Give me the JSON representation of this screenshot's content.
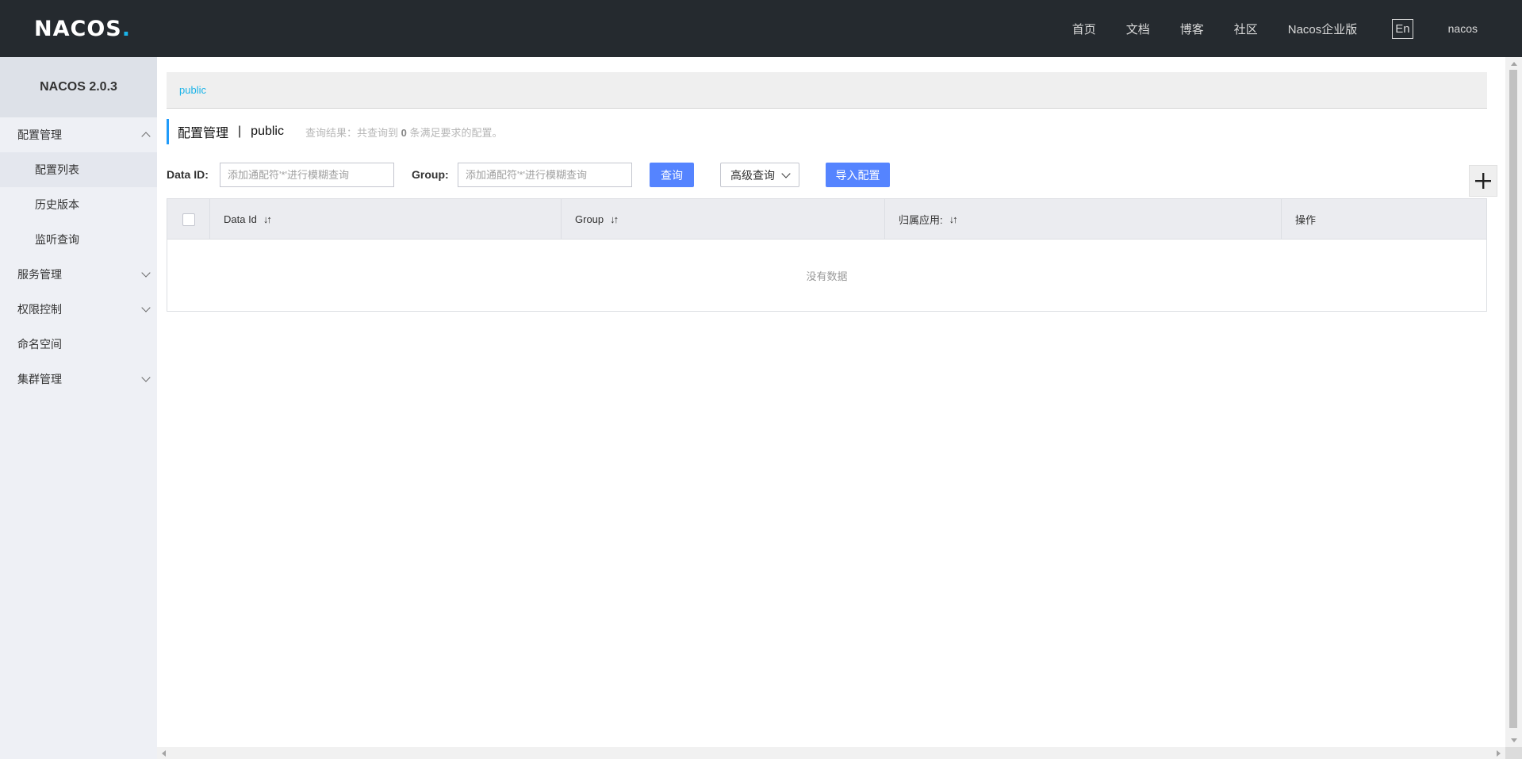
{
  "header": {
    "logo_prefix": "NA",
    "logo_mid": "CO",
    "logo_suffix": "S",
    "logo_dot": ".",
    "nav": [
      "首页",
      "文档",
      "博客",
      "社区",
      "Nacos企业版"
    ],
    "lang": "En",
    "user": "nacos"
  },
  "sidebar": {
    "version": "NACOS 2.0.3",
    "groups": [
      {
        "label": "配置管理",
        "expanded": true,
        "items": [
          "配置列表",
          "历史版本",
          "监听查询"
        ]
      },
      {
        "label": "服务管理",
        "expanded": false
      },
      {
        "label": "权限控制",
        "expanded": false
      },
      {
        "label": "命名空间"
      },
      {
        "label": "集群管理",
        "expanded": false
      }
    ]
  },
  "main": {
    "namespace_link": "public",
    "title": "配置管理",
    "title_sep": "|",
    "title_ns": "public",
    "result_prefix": "查询结果：共查询到",
    "result_count": "0",
    "result_suffix": "条满足要求的配置。",
    "search": {
      "dataid_label": "Data ID:",
      "dataid_placeholder": "添加通配符'*'进行模糊查询",
      "group_label": "Group:",
      "group_placeholder": "添加通配符'*'进行模糊查询",
      "query_btn": "查询",
      "advanced_btn": "高级查询",
      "import_btn": "导入配置",
      "add_btn": "+"
    },
    "table": {
      "columns": [
        "Data Id",
        "Group",
        "归属应用:",
        "操作"
      ],
      "sort_icon": "↓↑",
      "empty": "没有数据"
    }
  },
  "colors": {
    "header_bg": "#252a2f",
    "accent": "#1ab3e8",
    "primary_button": "#5584ff",
    "sidebar_bg": "#eef0f5"
  }
}
